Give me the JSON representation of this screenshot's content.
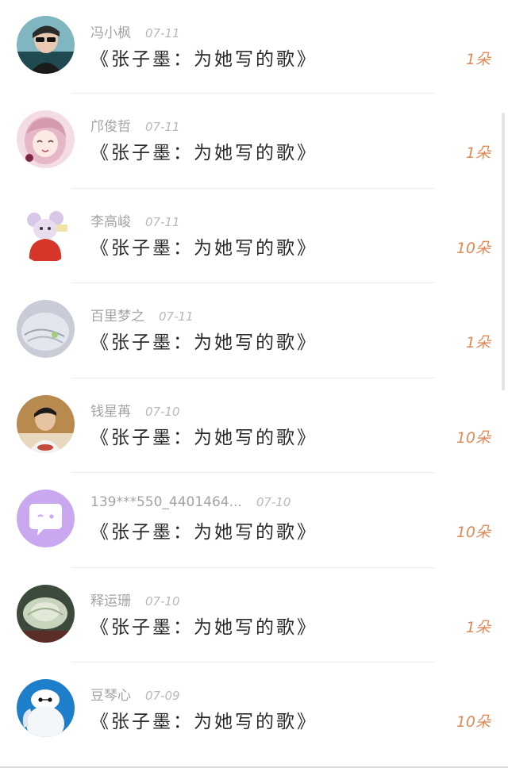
{
  "gift_list": {
    "items": [
      {
        "name": "冯小枫",
        "date": "07-11",
        "title": "《张子墨：为她写的歌》",
        "count": "1朵",
        "avatar_icon": "avatar-man-sunglasses"
      },
      {
        "name": "邝俊哲",
        "date": "07-11",
        "title": "《张子墨：为她写的歌》",
        "count": "1朵",
        "avatar_icon": "avatar-anime-girl"
      },
      {
        "name": "李高峻",
        "date": "07-11",
        "title": "《张子墨：为她写的歌》",
        "count": "10朵",
        "avatar_icon": "avatar-cartoon-mouse"
      },
      {
        "name": "百里梦之",
        "date": "07-11",
        "title": "《张子墨：为她写的歌》",
        "count": "1朵",
        "avatar_icon": "avatar-abstract-grey"
      },
      {
        "name": "钱星苒",
        "date": "07-10",
        "title": "《张子墨：为她写的歌》",
        "count": "10朵",
        "avatar_icon": "avatar-boy-photo"
      },
      {
        "name": "139***550_4401464...",
        "date": "07-10",
        "title": "《张子墨：为她写的歌》",
        "count": "10朵",
        "avatar_icon": "avatar-chat-bubble-default"
      },
      {
        "name": "释运珊",
        "date": "07-10",
        "title": "《张子墨：为她写的歌》",
        "count": "1朵",
        "avatar_icon": "avatar-cabbage-photo"
      },
      {
        "name": "豆琴心",
        "date": "07-09",
        "title": "《张子墨：为她写的歌》",
        "count": "10朵",
        "avatar_icon": "avatar-white-robot"
      }
    ]
  },
  "colors": {
    "count_accent": "#e08a58",
    "default_avatar": "#c9a8f0"
  }
}
